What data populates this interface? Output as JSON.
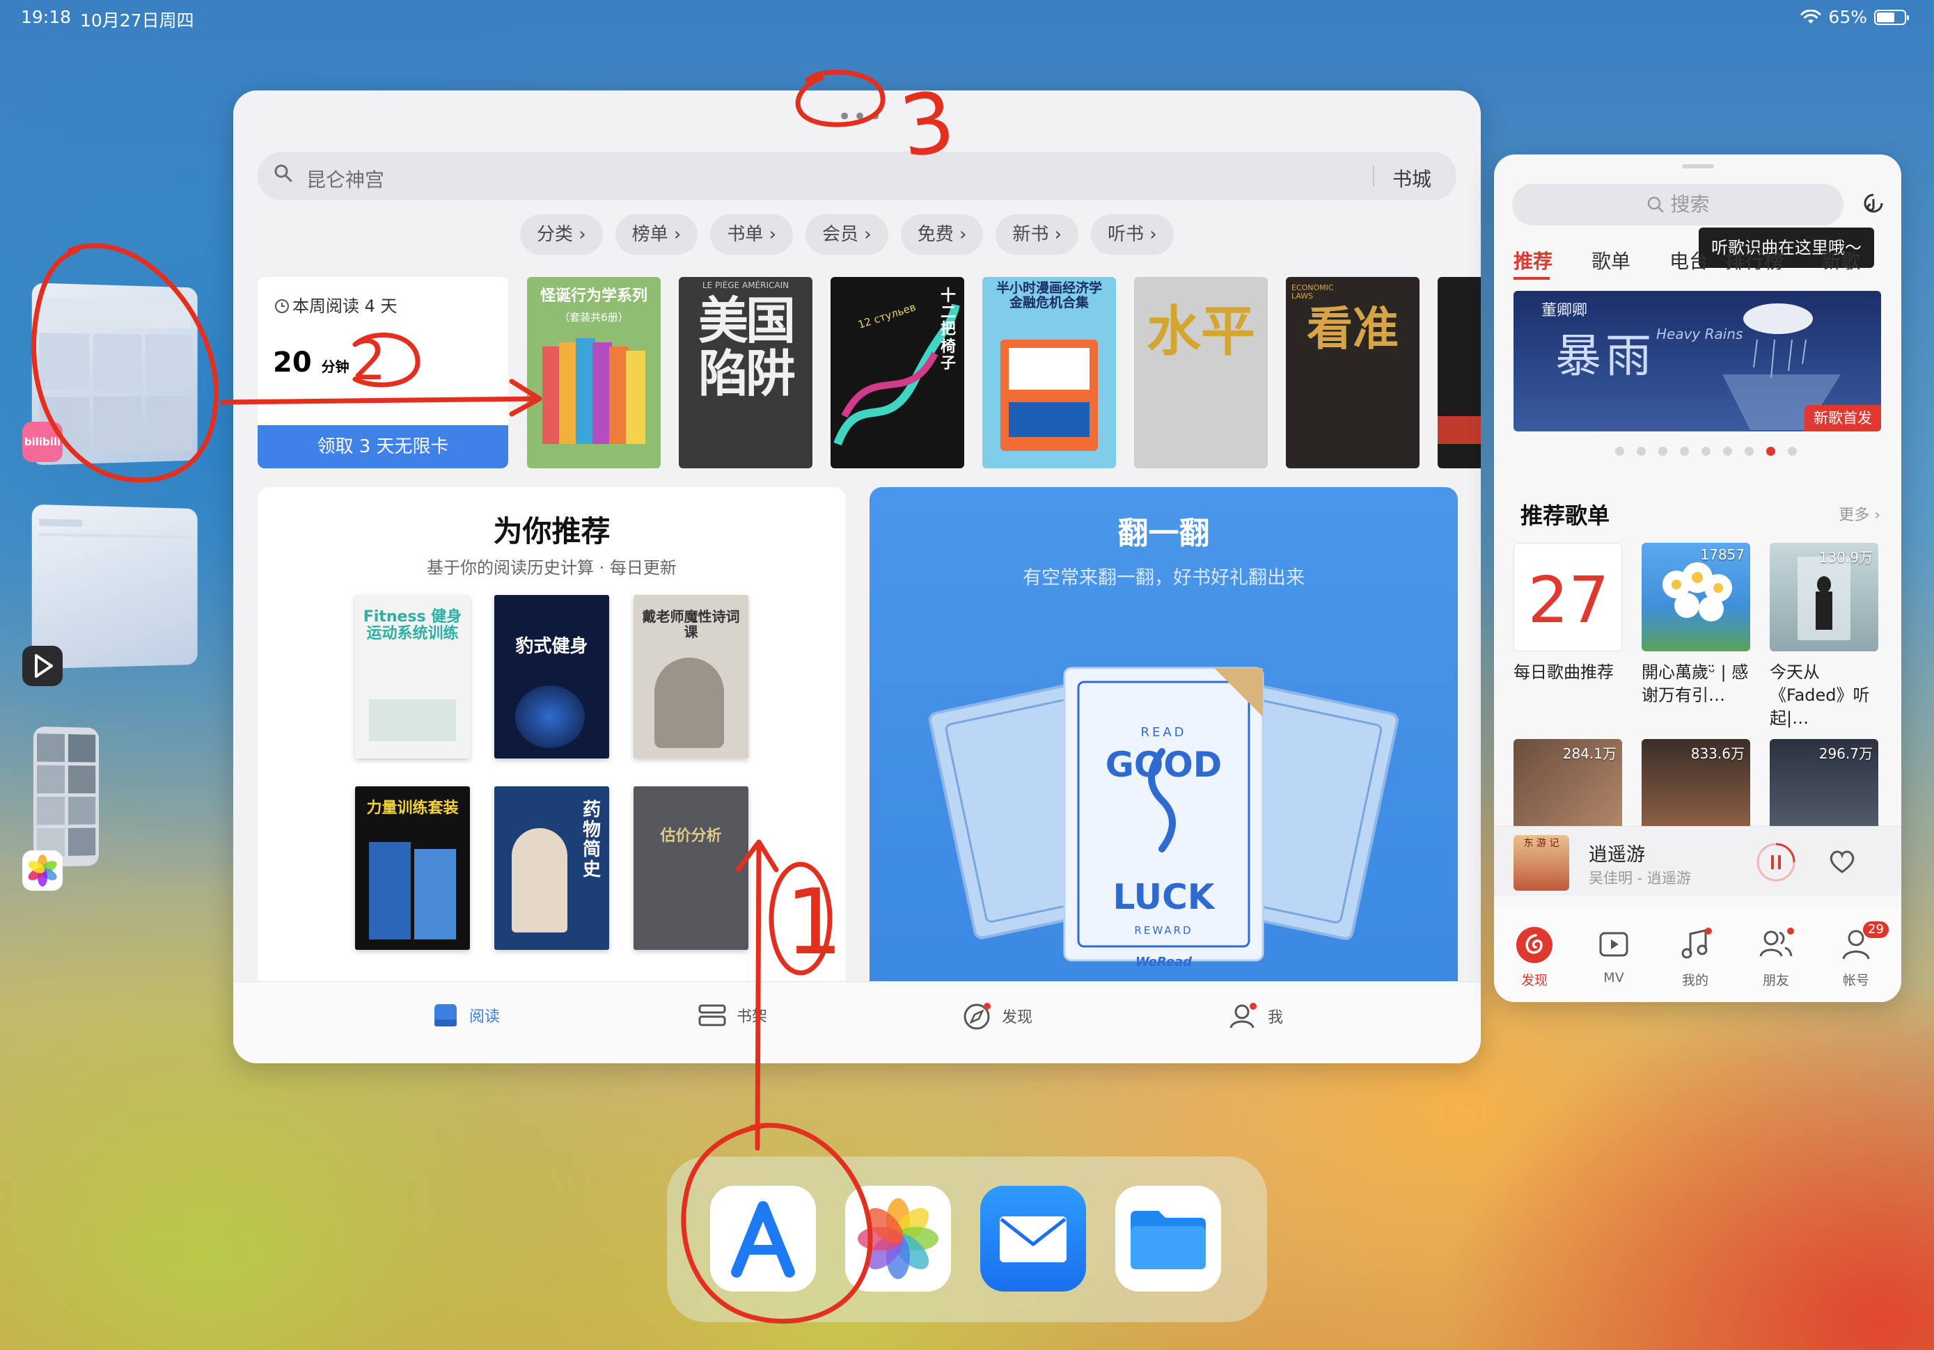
{
  "status_bar": {
    "time": "19:18",
    "date": "10月27日周四",
    "battery": "65%"
  },
  "reader": {
    "search_placeholder": "昆仑神宫",
    "store_button": "书城",
    "chips": [
      "分类 ›",
      "榜单 ›",
      "书单 ›",
      "会员 ›",
      "免费 ›",
      "新书 ›",
      "听书 ›"
    ],
    "weekly": {
      "label": "本周阅读 4 天",
      "minutes": "20",
      "minutes_unit": "分钟",
      "claim_button": "领取 3 天无限卡"
    },
    "shelf_books": [
      {
        "title": "怪诞行为学系列",
        "sub": "（套装共6册）"
      },
      {
        "title": "美国陷阱",
        "sub": "LE PIÈGE AMÉRICAIN"
      },
      {
        "title": "十二把椅子",
        "sub": "12 стульев"
      },
      {
        "title": "半小时漫画经济学 金融危机合集",
        "sub": ""
      },
      {
        "title": "水平",
        "sub": ""
      },
      {
        "title": "看准",
        "sub": "ECONOMIC LAWS"
      }
    ],
    "recommend": {
      "title": "为你推荐",
      "subtitle": "基于你的阅读历史计算 · 每日更新",
      "books": [
        "Fitness 健身运动系统训练",
        "豹式健身",
        "戴老师魔性诗词课",
        "力量训练套装",
        "药物简史",
        "估价分析"
      ]
    },
    "flip": {
      "title": "翻一翻",
      "subtitle": "有空常来翻一翻，好书好礼翻出来",
      "card_top": "READ",
      "card_main_1": "GOOD",
      "card_main_2": "LUCK",
      "card_bottom": "REWARD",
      "card_brand": "WeRead"
    },
    "tabs": [
      "阅读",
      "书架",
      "发现",
      "我"
    ]
  },
  "music": {
    "search_placeholder": "搜索",
    "tooltip": "听歌识曲在这里哦～",
    "tabs": [
      "推荐",
      "歌单",
      "电台",
      "排行榜",
      "新歌"
    ],
    "banner": {
      "artist": "董卿卿",
      "title": "暴雨",
      "title_en": "Heavy Rains",
      "tag": "新歌首发"
    },
    "section_title": "推荐歌单",
    "more": "更多 ›",
    "playlists": [
      {
        "name": "每日歌曲推荐",
        "count": "",
        "day": "27"
      },
      {
        "name": "開心萬歲ᵕ̈ | 感谢万有引…",
        "count": "17857"
      },
      {
        "name": "今天从《Faded》听起|…",
        "count": "130.9万"
      },
      {
        "name": "",
        "count": "284.1万"
      },
      {
        "name": "",
        "count": "833.6万"
      },
      {
        "name": "",
        "count": "296.7万"
      }
    ],
    "now_playing": {
      "title": "逍遥游",
      "artist": "吴佳明 - 逍遥游",
      "cover_text": "东 游 记"
    },
    "bottom_tabs": [
      "发现",
      "MV",
      "我的",
      "朋友",
      "帐号"
    ],
    "account_badge": "29"
  },
  "side_apps": {
    "bilibili_label": "bilibili"
  },
  "annotations": {
    "n1": "1",
    "n2": "2",
    "n3": "3"
  }
}
